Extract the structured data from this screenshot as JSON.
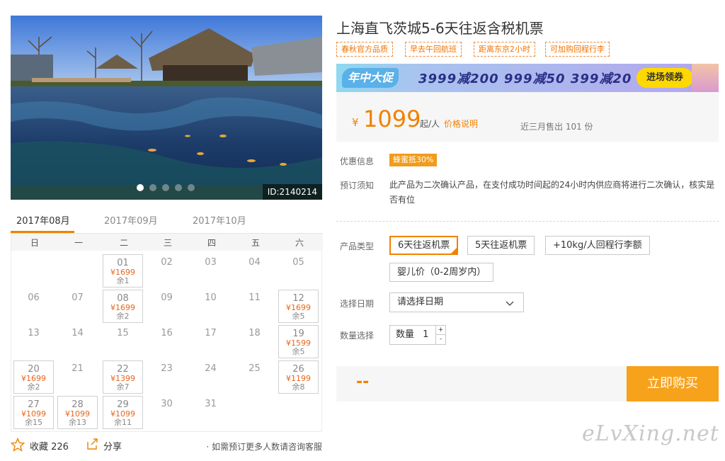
{
  "product": {
    "title": "上海直飞茨城5-6天往返含税机票",
    "photo_id": "ID:2140214",
    "tags": [
      "春秋官方品质",
      "早去午回航班",
      "距离东京2小时",
      "可加购回程行李"
    ]
  },
  "banner": {
    "headline": "年中大促",
    "offers": "3999减200 999减50 399减20",
    "button": "进场领券"
  },
  "price": {
    "currency": "¥",
    "amount": "1099",
    "unit": "起/人",
    "explain_link": "价格说明",
    "sold": "近三月售出 101 份"
  },
  "info": {
    "promo_label": "优惠信息",
    "promo_badge": "蜂蜜抵30%",
    "notice_label": "预订须知",
    "notice_text": "此产品为二次确认产品，在支付成功时间起的24小时内供应商将进行二次确认，核实是否有位"
  },
  "options": {
    "type_label": "产品类型",
    "types": [
      "6天往返机票",
      "5天往返机票",
      "+10kg/人回程行李额",
      "婴儿价（0-2周岁内）"
    ],
    "date_label": "选择日期",
    "date_placeholder": "请选择日期",
    "qty_label": "数量选择",
    "qty_prefix": "数量",
    "qty_value": "1",
    "qty_plus": "+",
    "qty_minus": "-"
  },
  "purchase": {
    "total": "--",
    "buy": "立即购买"
  },
  "calendar": {
    "months": [
      "2017年08月",
      "2017年09月",
      "2017年10月"
    ],
    "weekdays": [
      "日",
      "一",
      "二",
      "三",
      "四",
      "五",
      "六"
    ],
    "days": [
      {
        "d": "01",
        "price": "¥1699",
        "rest": "余1"
      },
      {
        "d": "02"
      },
      {
        "d": "03"
      },
      {
        "d": "04"
      },
      {
        "d": "05"
      },
      {
        "d": "06"
      },
      {
        "d": "07"
      },
      {
        "d": "08",
        "price": "¥1699",
        "rest": "余2"
      },
      {
        "d": "09"
      },
      {
        "d": "10"
      },
      {
        "d": "11"
      },
      {
        "d": "12",
        "price": "¥1699",
        "rest": "余5"
      },
      {
        "d": "13"
      },
      {
        "d": "14"
      },
      {
        "d": "15"
      },
      {
        "d": "16"
      },
      {
        "d": "17"
      },
      {
        "d": "18"
      },
      {
        "d": "19",
        "price": "¥1599",
        "rest": "余5"
      },
      {
        "d": "20",
        "price": "¥1699",
        "rest": "余2"
      },
      {
        "d": "21"
      },
      {
        "d": "22",
        "price": "¥1399",
        "rest": "余7"
      },
      {
        "d": "23"
      },
      {
        "d": "24"
      },
      {
        "d": "25"
      },
      {
        "d": "26",
        "price": "¥1199",
        "rest": "余8"
      },
      {
        "d": "27",
        "price": "¥1099",
        "rest": "余15"
      },
      {
        "d": "28",
        "price": "¥1099",
        "rest": "余13"
      },
      {
        "d": "29",
        "price": "¥1099",
        "rest": "余11"
      },
      {
        "d": "30"
      },
      {
        "d": "31"
      }
    ]
  },
  "footer": {
    "favorite": "收藏 226",
    "share": "分享",
    "contact": "· 如需预订更多人数请咨询客服"
  },
  "watermark": "eLvXing.net",
  "icons": [
    "star-icon",
    "share-icon",
    "chevron-down-icon"
  ],
  "colors": {
    "accent": "#f08200",
    "buy_button": "#f7a21b"
  }
}
